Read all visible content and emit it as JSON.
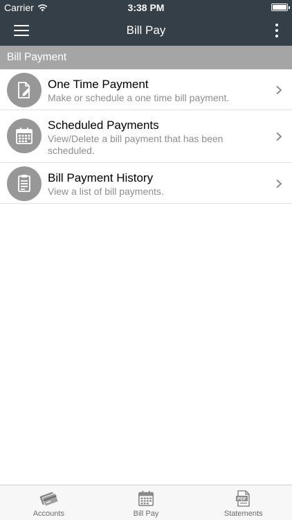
{
  "status_bar": {
    "carrier": "Carrier",
    "time": "3:38 PM"
  },
  "nav": {
    "title": "Bill Pay",
    "left_icon": "hamburger-menu-icon",
    "right_icon": "more-vertical-icon"
  },
  "section": {
    "title": "Bill Payment"
  },
  "items": [
    {
      "title": "One Time Payment",
      "subtitle": "Make or schedule a one time bill payment.",
      "icon": "document-pencil-icon"
    },
    {
      "title": "Scheduled Payments",
      "subtitle": "View/Delete a bill payment that has been scheduled.",
      "icon": "calendar-icon"
    },
    {
      "title": "Bill Payment History",
      "subtitle": "View a list of bill payments.",
      "icon": "document-list-icon"
    }
  ],
  "tabs": [
    {
      "label": "Accounts",
      "icon": "cards-icon"
    },
    {
      "label": "Bill Pay",
      "icon": "calendar-icon"
    },
    {
      "label": "Statements",
      "icon": "pdf-icon",
      "icon_text": "PDF"
    }
  ],
  "colors": {
    "header_bg": "#353f47",
    "section_bg": "#a5a5a5",
    "icon_circle": "#979797",
    "subtitle": "#8e8e8e"
  }
}
